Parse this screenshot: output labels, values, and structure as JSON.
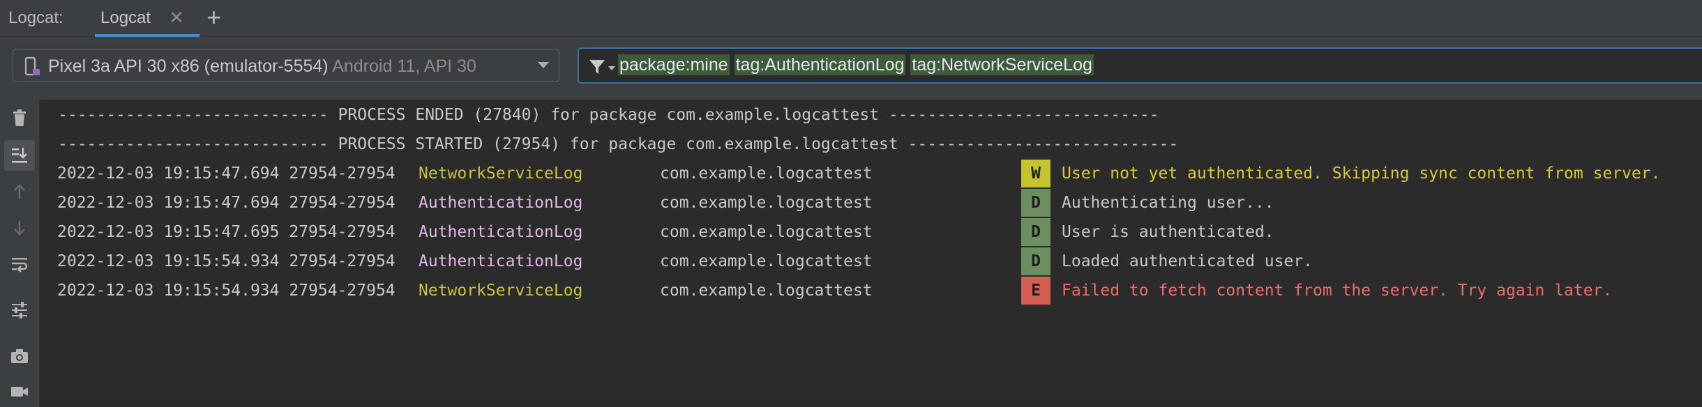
{
  "tabbar": {
    "title": "Logcat:",
    "tab_label": "Logcat",
    "close_glyph": "✕",
    "add_glyph": "+"
  },
  "toolbar": {
    "device_name": "Pixel 3a API 30 x86 (emulator-5554)",
    "device_api": "Android 11, API 30",
    "filter_chips": [
      "package:mine",
      "tag:AuthenticationLog",
      "tag:NetworkServiceLog"
    ]
  },
  "rail_icons": [
    "trash-icon",
    "scroll-to-end-icon",
    "arrow-up-icon",
    "arrow-down-icon",
    "soft-wrap-icon",
    "settings-sliders-icon",
    "camera-icon",
    "video-icon"
  ],
  "log": {
    "separators": [
      "---------------------------- PROCESS ENDED (27840) for package com.example.logcattest ----------------------------",
      "---------------------------- PROCESS STARTED (27954) for package com.example.logcattest ----------------------------"
    ],
    "entries": [
      {
        "timestamp": "2022-12-03 19:15:47.694 27954-27954",
        "tag": "NetworkServiceLog",
        "package": "com.example.logcattest",
        "level": "W",
        "message": "User not yet authenticated. Skipping sync content from server."
      },
      {
        "timestamp": "2022-12-03 19:15:47.694 27954-27954",
        "tag": "AuthenticationLog",
        "package": "com.example.logcattest",
        "level": "D",
        "message": "Authenticating user..."
      },
      {
        "timestamp": "2022-12-03 19:15:47.695 27954-27954",
        "tag": "AuthenticationLog",
        "package": "com.example.logcattest",
        "level": "D",
        "message": "User is authenticated."
      },
      {
        "timestamp": "2022-12-03 19:15:54.934 27954-27954",
        "tag": "AuthenticationLog",
        "package": "com.example.logcattest",
        "level": "D",
        "message": "Loaded authenticated user."
      },
      {
        "timestamp": "2022-12-03 19:15:54.934 27954-27954",
        "tag": "NetworkServiceLog",
        "package": "com.example.logcattest",
        "level": "E",
        "message": "Failed to fetch content from the server. Try again later."
      }
    ]
  },
  "colors": {
    "tag_network": "#c8c33d",
    "tag_auth": "#e1b7e6",
    "level_W_bg": "#c5c32f",
    "level_D_bg": "#6b8f5e",
    "level_E_bg": "#d55e52",
    "msg_W": "#d8c83b",
    "msg_D": "#c8c8c8",
    "msg_E": "#ef6b63",
    "level_text": "#1f1f1f"
  }
}
